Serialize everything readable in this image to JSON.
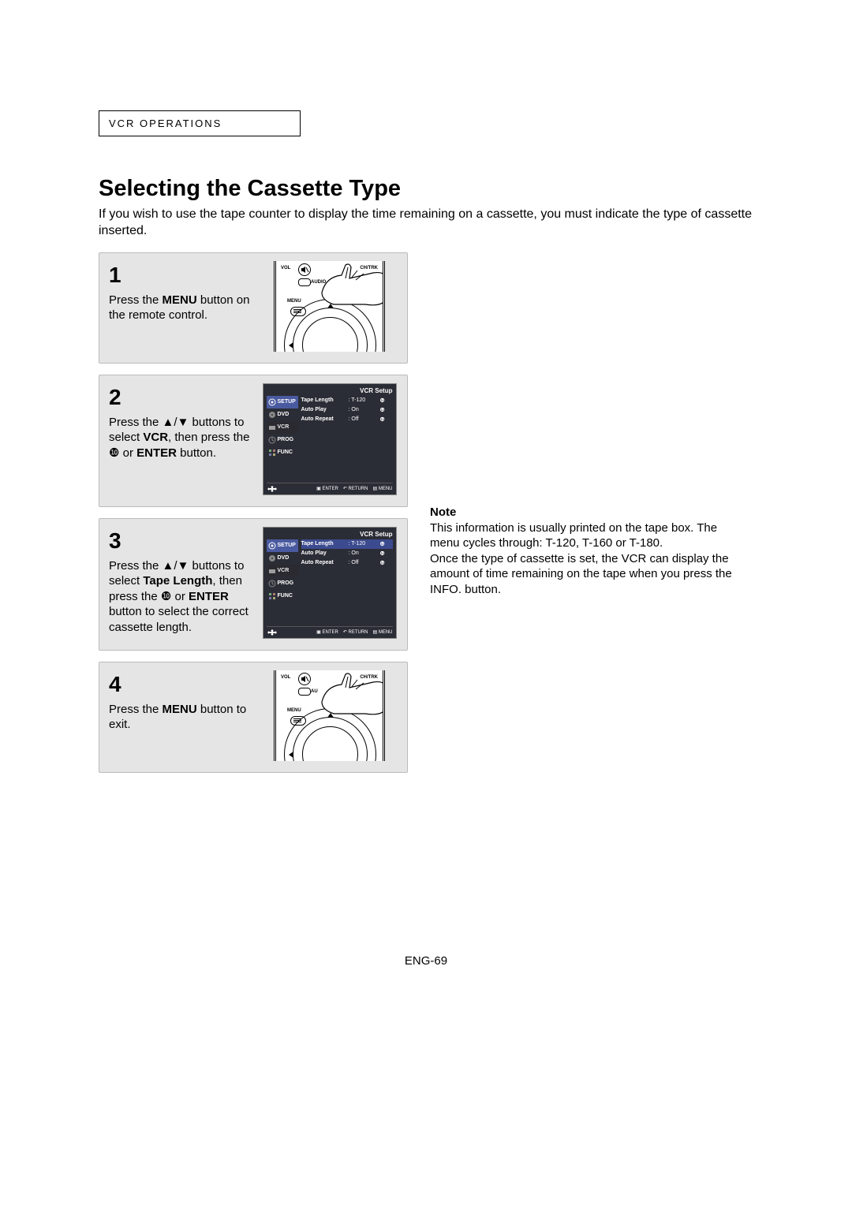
{
  "section_label": "VCR OPERATIONS",
  "title": "Selecting the Cassette Type",
  "intro": "If you wish to use the tape counter to display the time remaining on a cassette, you must indicate the type of cassette inserted.",
  "steps": {
    "s1": {
      "num": "1",
      "text_pre": "Press the ",
      "bold1": "MENU",
      "text_post": " button on the remote control."
    },
    "s2": {
      "num": "2",
      "line1": "Press the ▲/▼ buttons to select ",
      "bold1": "VCR",
      "line2": ", then press the ❿ or ",
      "bold2": "ENTER",
      "line3": " button."
    },
    "s3": {
      "num": "3",
      "line1": "Press the ▲/▼ buttons to select ",
      "bold1": "Tape Length",
      "line2": ", then press the ❿ or ",
      "bold2": "ENTER",
      "line3": " button to select the correct cassette length."
    },
    "s4": {
      "num": "4",
      "text_pre": "Press the ",
      "bold1": "MENU",
      "text_post": " button to exit."
    }
  },
  "osd": {
    "title": "VCR Setup",
    "sidebar": [
      "SETUP",
      "DVD",
      "VCR",
      "PROG",
      "FUNC"
    ],
    "rows": [
      {
        "k": "Tape Length",
        "v": ": T-120"
      },
      {
        "k": "Auto Play",
        "v": ": On"
      },
      {
        "k": "Auto Repeat",
        "v": ": Off"
      }
    ],
    "footer": [
      "ENTER",
      "RETURN",
      "MENU"
    ]
  },
  "remote": {
    "vol": "VOL",
    "chtrk": "CH/TRK",
    "audio": "AUDIO",
    "menu": "MENU"
  },
  "note": {
    "heading": "Note",
    "p1": "This information is usually printed on the tape box. The menu cycles through: T-120, T-160 or T-180.",
    "p2": "Once the type of cassette is set, the VCR can display the amount of time remaining on the tape when you press the INFO. button."
  },
  "page_num": "ENG-69"
}
